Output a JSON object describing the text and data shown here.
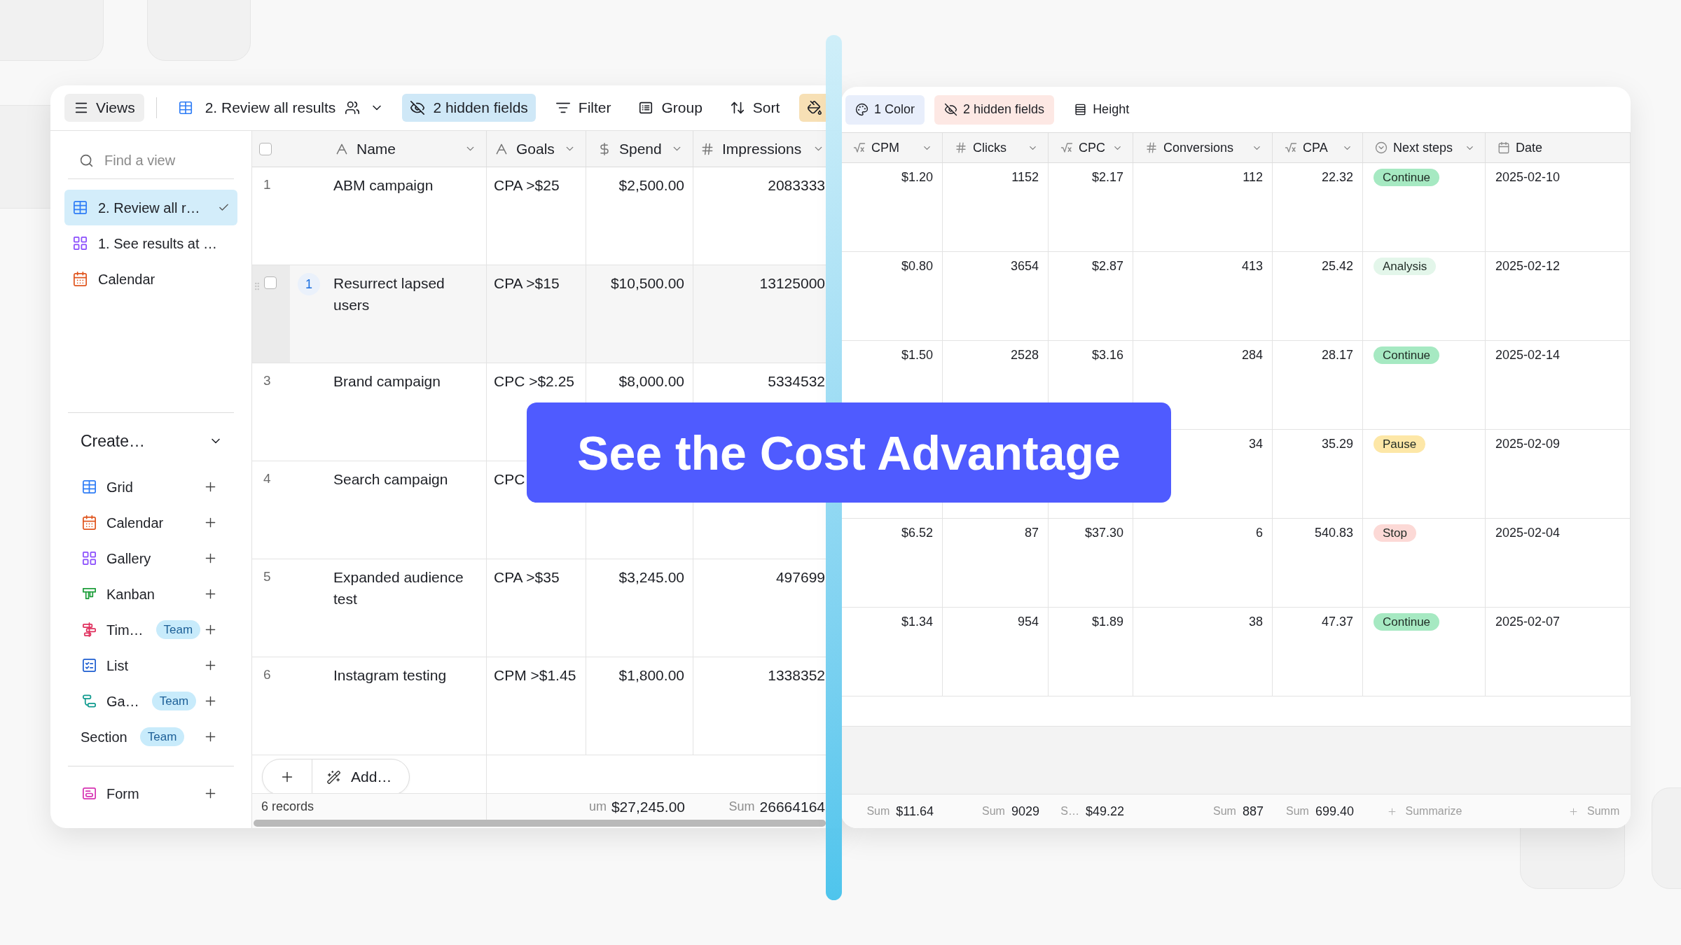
{
  "left_panel": {
    "toolbar": {
      "views_button": "Views",
      "view_switcher": "2. Review all results",
      "buttons": [
        {
          "kind": "hide",
          "label": "2 hidden fields",
          "color": "#cfe8f7"
        },
        {
          "kind": "filter",
          "label": "Filter"
        },
        {
          "kind": "group",
          "label": "Group"
        },
        {
          "kind": "sort",
          "label": "Sort"
        },
        {
          "kind": "color",
          "color": "#f7e0b5"
        }
      ]
    },
    "sidebar": {
      "search": {
        "placeholder": "Find a view"
      },
      "views": [
        {
          "kind": "grid",
          "label": "2. Review all r…",
          "selected": true
        },
        {
          "kind": "gallery",
          "label": "1. See results at …",
          "selected": false
        },
        {
          "kind": "calendar",
          "label": "Calendar",
          "selected": false
        }
      ],
      "create": {
        "title": "Create…",
        "expanded": true,
        "items": [
          {
            "kind": "grid",
            "label": "Grid"
          },
          {
            "kind": "calendar",
            "label": "Calendar"
          },
          {
            "kind": "gallery",
            "label": "Gallery"
          },
          {
            "kind": "kanban",
            "label": "Kanban"
          },
          {
            "kind": "timeline",
            "label": "Tim…",
            "badge": "Team"
          },
          {
            "kind": "list",
            "label": "List"
          },
          {
            "kind": "gantt",
            "label": "Ga…",
            "badge": "Team"
          },
          {
            "kind": "section",
            "label": "Section",
            "badge": "Team"
          }
        ]
      },
      "extra_items": [
        {
          "kind": "form",
          "label": "Form"
        }
      ]
    },
    "grid": {
      "select_all_checked": false,
      "columns": [
        {
          "kind": "text",
          "label": "Name",
          "menu": true
        },
        {
          "kind": "text",
          "label": "Goals",
          "menu": true
        },
        {
          "kind": "currency",
          "label": "Spend",
          "menu": true
        },
        {
          "kind": "number",
          "label": "Impressions",
          "menu": true
        }
      ],
      "rows": [
        {
          "number": "1",
          "hovered": false,
          "cells": [
            "ABM campaign",
            "CPA >$25",
            "$2,500.00",
            "2083333"
          ]
        },
        {
          "hovered": true,
          "checked": false,
          "comments": "1",
          "cells": [
            "Resurrect lapsed users",
            "CPA >$15",
            "$10,500.00",
            "13125000"
          ]
        },
        {
          "number": "3",
          "hovered": false,
          "cells": [
            "Brand campaign",
            "CPC >$2.25",
            "$8,000.00",
            "5334532"
          ]
        },
        {
          "number": "4",
          "hovered": false,
          "cells": [
            "Search campaign",
            "CPC",
            null,
            null
          ]
        },
        {
          "number": "5",
          "hovered": false,
          "cells": [
            "Expanded audience test",
            "CPA >$35",
            "$3,245.00",
            "497699"
          ]
        },
        {
          "number": "6",
          "hovered": false,
          "cells": [
            "Instagram testing",
            "CPM >$1.45",
            "$1,800.00",
            "1338352"
          ]
        }
      ],
      "add_button": "Add…",
      "footer": {
        "records": "6 records",
        "summaries": [
          {
            "label": "um",
            "value": "$27,245.00"
          },
          {
            "label": "Sum",
            "value": "26664164"
          }
        ]
      }
    }
  },
  "right_panel": {
    "toolbar": {
      "buttons": [
        {
          "kind": "palette",
          "label": "1 Color",
          "color": "#e8eefb"
        },
        {
          "kind": "hide",
          "label": "2 hidden fields",
          "color": "#fde8e4"
        },
        {
          "kind": "height",
          "label": "Height"
        }
      ]
    },
    "grid": {
      "columns": [
        {
          "kind": "formula",
          "label": "CPM",
          "menu": true
        },
        {
          "kind": "number",
          "label": "Clicks",
          "menu": true
        },
        {
          "kind": "formula",
          "label": "CPC",
          "menu": true
        },
        {
          "kind": "number",
          "label": "Conversions",
          "menu": true
        },
        {
          "kind": "formula",
          "label": "CPA",
          "menu": true
        },
        {
          "kind": "select",
          "label": "Next steps",
          "menu": true
        },
        {
          "kind": "date",
          "label": "Date",
          "menu": false
        }
      ],
      "rows": [
        [
          "$1.20",
          "1152",
          "$2.17",
          "112",
          "22.32",
          {
            "label": "Continue",
            "color": "#a6e9c2"
          },
          "2025-02-10"
        ],
        [
          "$0.80",
          "3654",
          "$2.87",
          "413",
          "25.42",
          {
            "label": "Analysis",
            "color": "#e3f6ea"
          },
          "2025-02-12"
        ],
        [
          "$1.50",
          "2528",
          "$3.16",
          "284",
          "28.17",
          {
            "label": "Continue",
            "color": "#a6e9c2"
          },
          "2025-02-14"
        ],
        [
          null,
          null,
          null,
          "34",
          "35.29",
          {
            "label": "Pause",
            "color": "#fde7a7"
          },
          "2025-02-09"
        ],
        [
          "$6.52",
          "87",
          "$37.30",
          "6",
          "540.83",
          {
            "label": "Stop",
            "color": "#fcd9d6"
          },
          "2025-02-04"
        ],
        [
          "$1.34",
          "954",
          "$1.89",
          "38",
          "47.37",
          {
            "label": "Continue",
            "color": "#a6e9c2"
          },
          "2025-02-07"
        ]
      ],
      "footer": {
        "summaries": [
          {
            "kind": "sum",
            "label": "Sum",
            "value": "$11.64"
          },
          {
            "kind": "sum",
            "label": "Sum",
            "value": "9029"
          },
          {
            "kind": "sum",
            "label": "S…",
            "value": "$49.22"
          },
          {
            "kind": "sum",
            "label": "Sum",
            "value": "887"
          },
          {
            "kind": "sum",
            "label": "Sum",
            "value": "699.40"
          },
          {
            "kind": "summarize",
            "label": "Summarize"
          },
          {
            "kind": "summarize",
            "label": "Summ"
          }
        ]
      }
    }
  },
  "banner": {
    "title": "See the Cost Advantage"
  }
}
